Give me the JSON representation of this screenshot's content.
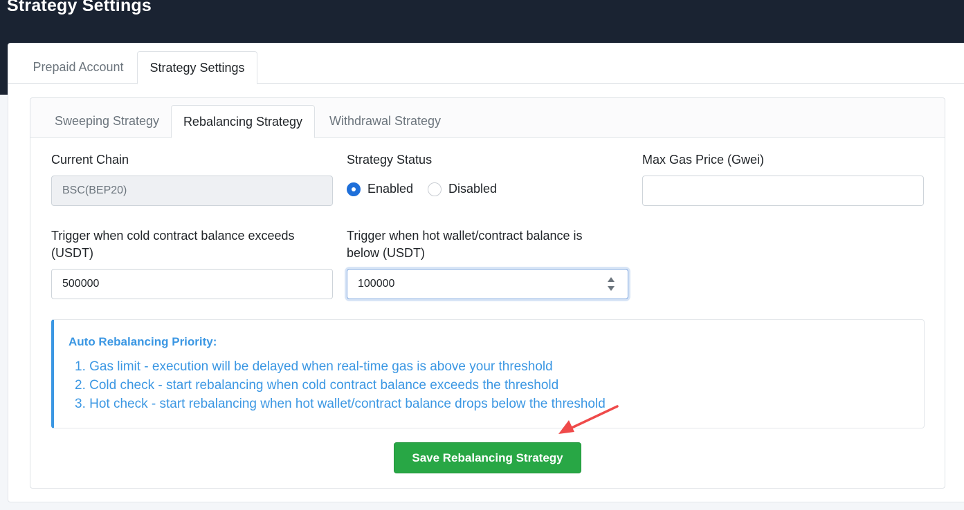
{
  "page": {
    "title": "Strategy Settings"
  },
  "outer_tabs": [
    {
      "label": "Prepaid Account",
      "active": false
    },
    {
      "label": "Strategy Settings",
      "active": true
    }
  ],
  "inner_tabs": [
    {
      "label": "Sweeping Strategy",
      "active": false
    },
    {
      "label": "Rebalancing Strategy",
      "active": true
    },
    {
      "label": "Withdrawal Strategy",
      "active": false
    }
  ],
  "form": {
    "current_chain": {
      "label": "Current Chain",
      "value": "BSC(BEP20)"
    },
    "strategy_status": {
      "label": "Strategy Status",
      "options": [
        {
          "label": "Enabled",
          "checked": true
        },
        {
          "label": "Disabled",
          "checked": false
        }
      ]
    },
    "max_gas_price": {
      "label": "Max Gas Price (Gwei)",
      "value": ""
    },
    "cold_trigger": {
      "label_line1": "Trigger when cold contract balance exceeds",
      "label_line2": "(USDT)",
      "value": "500000"
    },
    "hot_trigger": {
      "label_line1": "Trigger when hot wallet/contract balance is",
      "label_line2": "below (USDT)",
      "value": "100000"
    }
  },
  "priority": {
    "title": "Auto Rebalancing Priority:",
    "items": [
      "1. Gas limit - execution will be delayed when real-time gas is above your threshold",
      "2. Cold check - start rebalancing when cold contract balance exceeds the threshold",
      "3. Hot check - start rebalancing when hot wallet/contract balance drops below the threshold"
    ]
  },
  "save_button": {
    "label": "Save Rebalancing Strategy"
  },
  "colors": {
    "header_bg": "#1a2332",
    "accent_blue": "#3b97e3",
    "radio_blue": "#1e6fd9",
    "save_green": "#28a745",
    "annotation_arrow": "#ef4a4a"
  }
}
